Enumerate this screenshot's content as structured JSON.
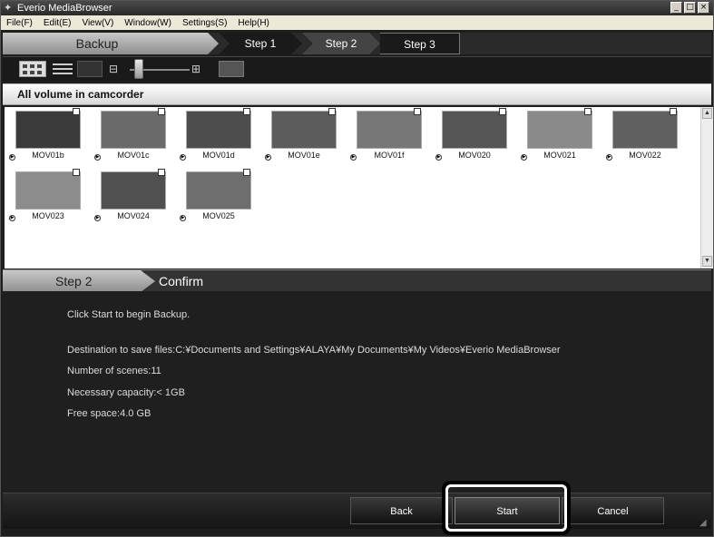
{
  "window": {
    "title": "Everio MediaBrowser",
    "controls": [
      "_",
      "□",
      "×"
    ]
  },
  "menu": [
    "File(F)",
    "Edit(E)",
    "View(V)",
    "Window(W)",
    "Settings(S)",
    "Help(H)"
  ],
  "steps": {
    "current_task": "Backup",
    "step1": "Step 1",
    "step2": "Step 2",
    "step3": "Step 3"
  },
  "panel": {
    "title": "All volume in camcorder"
  },
  "thumbnails": [
    {
      "label": "MOV01b",
      "color": "#3b3b3b"
    },
    {
      "label": "MOV01c",
      "color": "#6a6a6a"
    },
    {
      "label": "MOV01d",
      "color": "#4d4d4d"
    },
    {
      "label": "MOV01e",
      "color": "#5c5c5c"
    },
    {
      "label": "MOV01f",
      "color": "#777777"
    },
    {
      "label": "MOV020",
      "color": "#555555"
    },
    {
      "label": "MOV021",
      "color": "#8a8a8a"
    },
    {
      "label": "MOV022",
      "color": "#606060"
    },
    {
      "label": "MOV023",
      "color": "#8c8c8c"
    },
    {
      "label": "MOV024",
      "color": "#505050"
    },
    {
      "label": "MOV025",
      "color": "#6e6e6e"
    }
  ],
  "confirm": {
    "step": "Step 2",
    "title": "Confirm",
    "instruction": "Click Start to begin Backup.",
    "destination": "Destination to save files:C:¥Documents and Settings¥ALAYA¥My Documents¥My Videos¥Everio MediaBrowser",
    "scenes": "Number of scenes:11",
    "capacity": "Necessary capacity:< 1GB",
    "free_space": "Free space:4.0 GB"
  },
  "buttons": {
    "back": "Back",
    "start": "Start",
    "cancel": "Cancel"
  }
}
